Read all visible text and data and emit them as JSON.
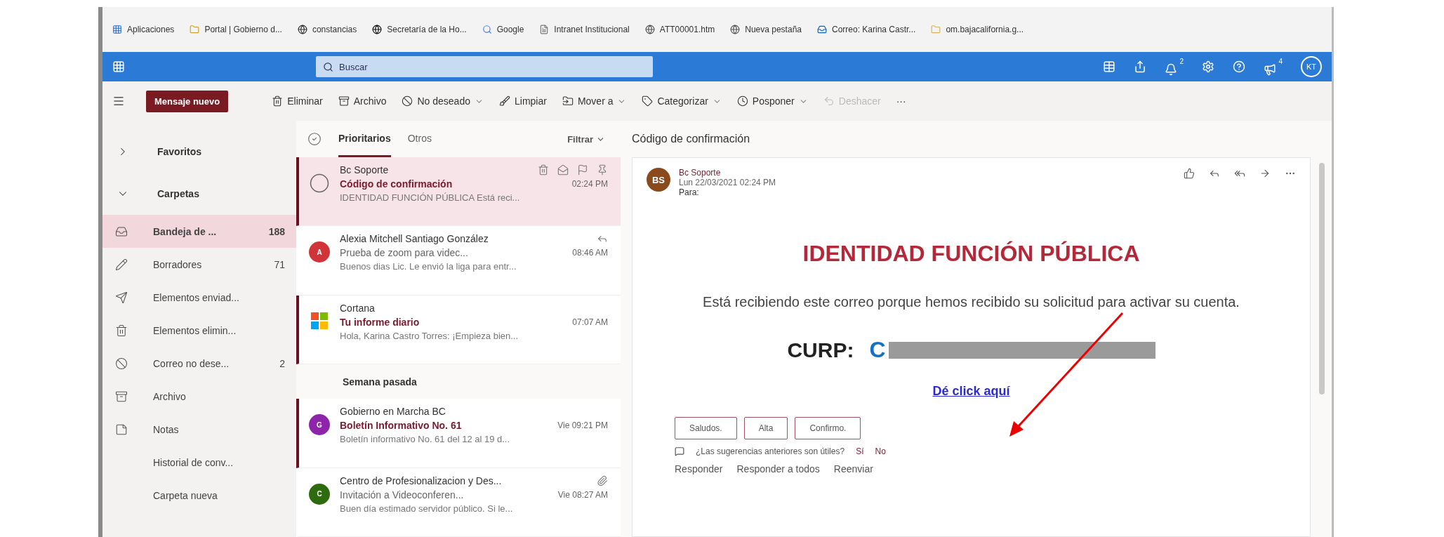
{
  "bookmarks": [
    {
      "label": "Aplicaciones"
    },
    {
      "label": "Portal | Gobierno d..."
    },
    {
      "label": "constancias"
    },
    {
      "label": "Secretaría de la Ho..."
    },
    {
      "label": "Google"
    },
    {
      "label": "Intranet Institucional"
    },
    {
      "label": "ATT00001.htm"
    },
    {
      "label": "Nueva pestaña"
    },
    {
      "label": "Correo: Karina Castr..."
    },
    {
      "label": "om.bajacalifornia.g..."
    }
  ],
  "topbar": {
    "search": {
      "placeholder": "Buscar"
    },
    "badges": [
      "2",
      "4"
    ],
    "avatar": "KT"
  },
  "toolbar": {
    "new_message": "Mensaje nuevo",
    "actions": [
      {
        "label": "Eliminar",
        "dropdown": false,
        "disabled": false
      },
      {
        "label": "Archivo",
        "dropdown": false,
        "disabled": false
      },
      {
        "label": "No deseado",
        "dropdown": true,
        "disabled": false
      },
      {
        "label": "Limpiar",
        "dropdown": false,
        "disabled": false
      },
      {
        "label": "Mover a",
        "dropdown": true,
        "disabled": false
      },
      {
        "label": "Categorizar",
        "dropdown": true,
        "disabled": false
      },
      {
        "label": "Posponer",
        "dropdown": true,
        "disabled": false
      },
      {
        "label": "Deshacer",
        "dropdown": false,
        "disabled": true
      }
    ],
    "more": "···"
  },
  "nav": {
    "groups": [
      {
        "label": "Favoritos",
        "expanded": false
      },
      {
        "label": "Carpetas",
        "expanded": true
      }
    ],
    "folders": [
      {
        "label": "Bandeja de ...",
        "count": "188",
        "selected": true
      },
      {
        "label": "Borradores",
        "count": "71",
        "selected": false
      },
      {
        "label": "Elementos enviad...",
        "selected": false
      },
      {
        "label": "Elementos elimin...",
        "selected": false
      },
      {
        "label": "Correo no dese...",
        "count": "2",
        "selected": false
      },
      {
        "label": "Archivo",
        "selected": false
      },
      {
        "label": "Notas",
        "selected": false
      },
      {
        "label": "Historial de conv...",
        "selected": false
      },
      {
        "label": "Carpeta nueva",
        "selected": false
      }
    ]
  },
  "message_list": {
    "tabs": [
      {
        "label": "Prioritarios",
        "selected": true
      },
      {
        "label": "Otros",
        "selected": false
      }
    ],
    "filter": "Filtrar",
    "entries": [
      {
        "kind": "message",
        "sender": "Bc Soporte",
        "subject": "Código de confirmación",
        "time": "02:24 PM",
        "preview": "IDENTIDAD FUNCIÓN PÚBLICA Está reci...",
        "unread": true,
        "selected": true
      },
      {
        "kind": "message",
        "sender": "Alexia Mitchell Santiago González",
        "subject": "Prueba de zoom para videc...",
        "time": "08:46 AM",
        "preview": "Buenos dias Lic. Le envió la liga para entr...",
        "unread": false,
        "selected": false,
        "initial": "A",
        "color": "#d13438",
        "replied": true
      },
      {
        "kind": "message",
        "sender": "Cortana",
        "subject": "Tu informe diario",
        "time": "07:07 AM",
        "preview": "Hola, Karina Castro Torres: ¡Empieza bien...",
        "unread": true,
        "selected": false,
        "logo": true
      },
      {
        "kind": "heading",
        "label": "Semana pasada"
      },
      {
        "kind": "message",
        "sender": "Gobierno en Marcha BC",
        "subject": "Boletín Informativo No. 61",
        "time": "Vie 09:21 PM",
        "preview": "Boletín informativo No. 61 del 12 al 19 d...",
        "unread": true,
        "selected": false,
        "initial": "G",
        "color": "#8e24aa"
      },
      {
        "kind": "message",
        "sender": "Centro de Profesionalizacion y Des...",
        "subject": "Invitación a Videoconferen...",
        "time": "Vie 08:27 AM",
        "preview": "Buen día estimado servidor público. Si le...",
        "unread": false,
        "selected": false,
        "initial": "C",
        "color": "#2e6b0f",
        "attachment": true
      }
    ]
  },
  "reading_pane": {
    "subject": "Código de confirmación",
    "sender": "Bc Soporte",
    "date": "Lun 22/03/2021 02:24 PM",
    "to": "Para:",
    "avatar": "BS",
    "body": {
      "title": "IDENTIDAD FUNCIÓN PÚBLICA",
      "text": "Está recibiendo este correo porque hemos recibido su solicitud para activar su cuenta.",
      "curp_label": "CURP:",
      "curp_value": "C",
      "link": "Dé click aquí"
    },
    "suggestions": [
      "Saludos.",
      "Alta",
      "Confirmo."
    ],
    "feedback": {
      "question": "¿Las sugerencias anteriores son útiles?",
      "yes": "Sí",
      "no": "No"
    },
    "replies": [
      "Responder",
      "Responder a todos",
      "Reenviar"
    ]
  }
}
